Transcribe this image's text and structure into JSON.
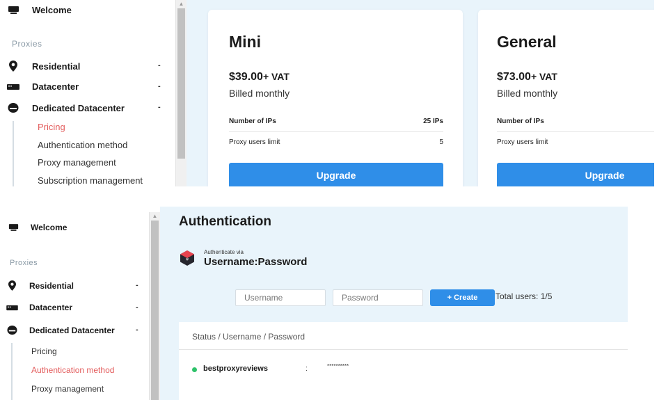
{
  "sidebar": {
    "welcome": "Welcome",
    "section": "Proxies",
    "items": [
      {
        "label": "Residential",
        "caret": "-"
      },
      {
        "label": "Datacenter",
        "caret": "-"
      },
      {
        "label": "Dedicated Datacenter",
        "caret": "-"
      }
    ],
    "sub_items_top": [
      "Pricing",
      "Authentication method",
      "Proxy management",
      "Subscription management"
    ],
    "sub_items_bottom": [
      "Pricing",
      "Authentication method",
      "Proxy management"
    ],
    "active_top": "Pricing",
    "active_bottom": "Authentication method"
  },
  "pricing": {
    "cards": [
      {
        "name": "Mini",
        "price": "$39.00",
        "vat": "+ VAT",
        "billing": "Billed monthly",
        "rows": [
          {
            "label": "Number of IPs",
            "value": "25 IPs"
          },
          {
            "label": "Proxy users limit",
            "value": "5"
          }
        ],
        "button": "Upgrade"
      },
      {
        "name": "General",
        "price": "$73.00",
        "vat": "+ VAT",
        "billing": "Billed monthly",
        "rows": [
          {
            "label": "Number of IPs",
            "value": ""
          },
          {
            "label": "Proxy users limit",
            "value": ""
          }
        ],
        "button": "Upgrade"
      }
    ]
  },
  "auth": {
    "title": "Authentication",
    "via_label": "Authenticate via",
    "method": "Username:Password",
    "username_placeholder": "Username",
    "password_placeholder": "Password",
    "create_label": "+  Create",
    "total_users": "Total users: 1/5",
    "table_header": "Status / Username / Password",
    "users": [
      {
        "username": "bestproxyreviews",
        "separator": ":",
        "password": "**********",
        "status_color": "#2ec26a"
      }
    ]
  },
  "colors": {
    "accent": "#2f8ee8",
    "active_nav": "#e35d5d",
    "content_bg": "#e9f4fb"
  }
}
